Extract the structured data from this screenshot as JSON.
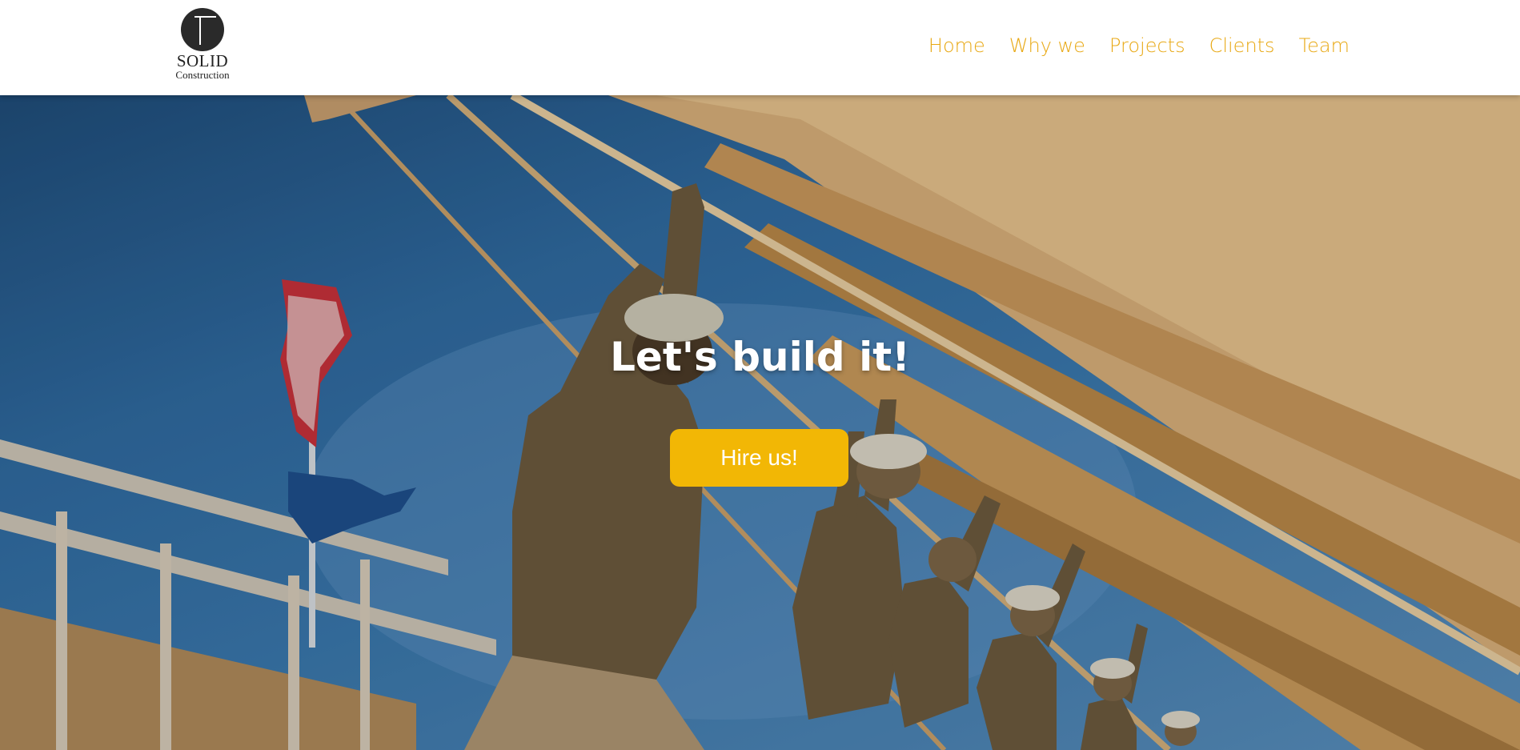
{
  "brand": {
    "name": "SOLID",
    "subtitle": "Construction"
  },
  "nav": {
    "items": [
      {
        "label": "Home"
      },
      {
        "label": "Why we"
      },
      {
        "label": "Projects"
      },
      {
        "label": "Clients"
      },
      {
        "label": "Team"
      }
    ]
  },
  "hero": {
    "title": "Let's build it!",
    "cta_label": "Hire us!",
    "background_image": "construction-workers-lifting-roof-truss-photo"
  },
  "colors": {
    "accent": "#f2b705",
    "nav_text": "#e8a813",
    "hero_text": "#ffffff"
  }
}
